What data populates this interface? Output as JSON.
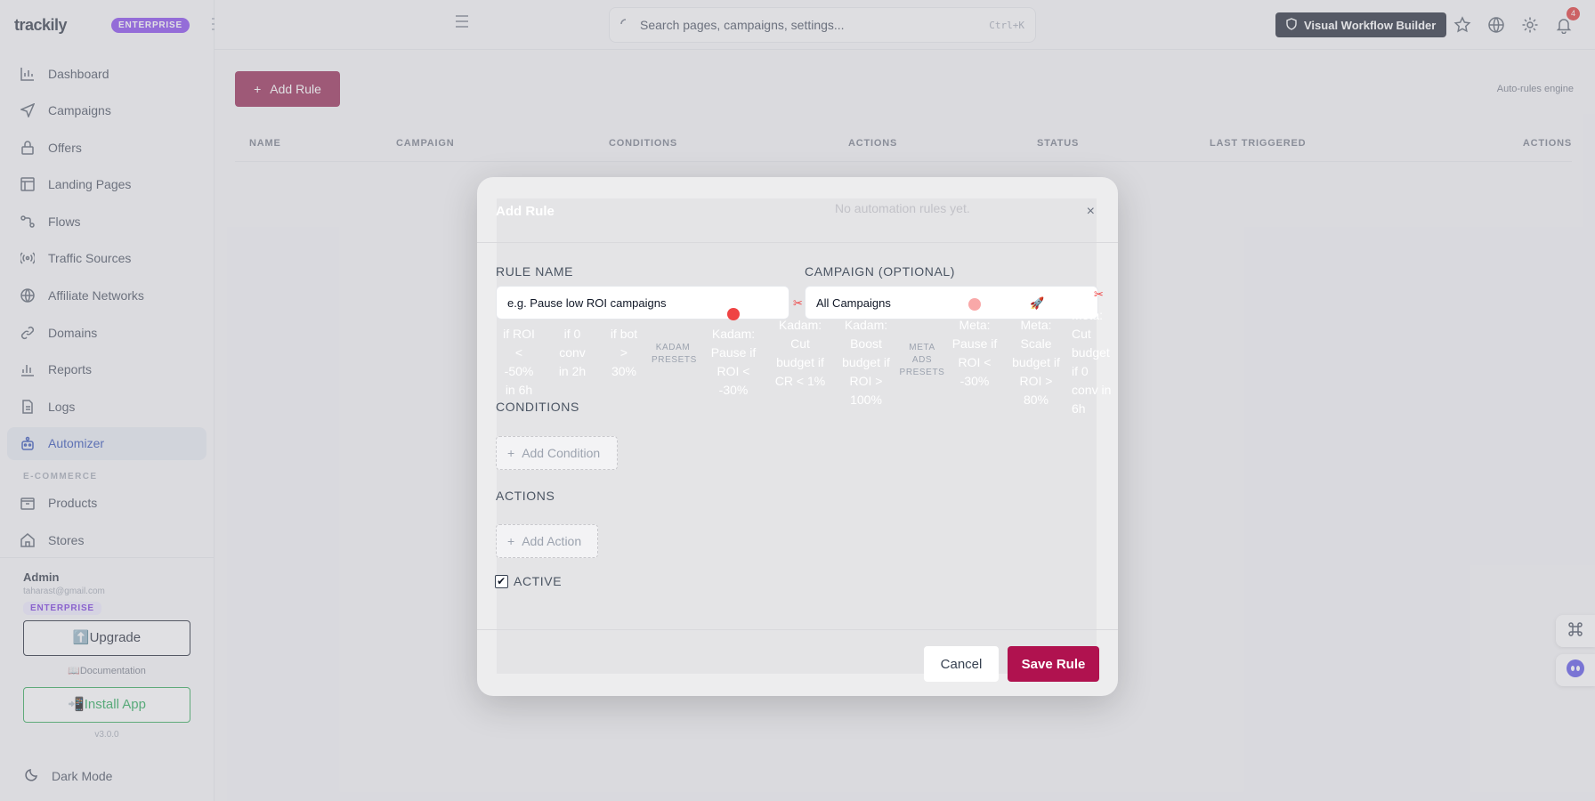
{
  "brand": {
    "logo": "trackily",
    "edition": "ENTERPRISE"
  },
  "sidebar": {
    "items": [
      {
        "label": "Dashboard",
        "icon": "chart-bar-icon"
      },
      {
        "label": "Campaigns",
        "icon": "send-icon"
      },
      {
        "label": "Offers",
        "icon": "lock-bag-icon"
      },
      {
        "label": "Landing Pages",
        "icon": "layout-icon"
      },
      {
        "label": "Flows",
        "icon": "flow-icon"
      },
      {
        "label": "Traffic Sources",
        "icon": "broadcast-icon"
      },
      {
        "label": "Affiliate Networks",
        "icon": "globe-icon"
      },
      {
        "label": "Domains",
        "icon": "link-icon"
      },
      {
        "label": "Reports",
        "icon": "report-icon"
      },
      {
        "label": "Logs",
        "icon": "file-icon"
      },
      {
        "label": "Automizer",
        "icon": "robot-icon",
        "active": true
      }
    ],
    "section_ecommerce": "E-COMMERCE",
    "ecommerce_items": [
      {
        "label": "Products",
        "icon": "box-icon"
      },
      {
        "label": "Stores",
        "icon": "store-icon"
      }
    ],
    "user": {
      "name": "Admin",
      "email": "taharast@gmail.com",
      "badge": "ENTERPRISE"
    },
    "upgrade_label": "⬆️Upgrade",
    "documentation_label": "📖Documentation",
    "install_label": "📲Install App",
    "version": "v3.0.0",
    "dark_mode_label": "Dark Mode"
  },
  "topbar": {
    "search_placeholder": "Search pages, campaigns, settings...",
    "search_shortcut": "Ctrl+K",
    "workflow_button": "Visual Workflow Builder",
    "notification_count": "4"
  },
  "main": {
    "add_rule_label": "Add Rule",
    "engine_label": "Auto-rules engine",
    "empty_text": "No automation rules yet.",
    "columns": [
      "NAME",
      "CAMPAIGN",
      "CONDITIONS",
      "ACTIONS",
      "STATUS",
      "LAST TRIGGERED",
      "ACTIONS"
    ]
  },
  "modal": {
    "title": "Add Rule",
    "close": "×",
    "rule_name_label": "RULE NAME",
    "rule_name_value": "e.g. Pause low ROI campaigns",
    "campaign_label": "CAMPAIGN (OPTIONAL)",
    "campaign_value": "All Campaigns",
    "presets": {
      "p1": "if ROI < -50% in 6h",
      "p2": "if 0 conv in 2h",
      "p3": "if bot > 30%",
      "kadam_head": "KADAM PRESETS",
      "k1": "Kadam: Pause if ROI < -30%",
      "k2": "Kadam: Cut budget if CR < 1%",
      "k3": "Kadam: Boost budget if ROI > 100%",
      "meta_head": "META ADS PRESETS",
      "m1": "Meta: Pause if ROI < -30%",
      "m2": "Meta: Scale budget if ROI > 80%",
      "m3": "Meta: Cut budget if 0 conv in 6h"
    },
    "conditions_label": "CONDITIONS",
    "add_condition": "Add Condition",
    "actions_label": "ACTIONS",
    "add_action": "Add Action",
    "active_label": "ACTIVE",
    "active_checked": true,
    "cancel_label": "Cancel",
    "save_label": "Save Rule"
  },
  "colors": {
    "brand_purple": "#7c3aed",
    "primary_button": "#8e1746",
    "save_button": "#b0124f",
    "active_nav_bg": "#e6ebf2",
    "install_green": "#16a34a"
  }
}
